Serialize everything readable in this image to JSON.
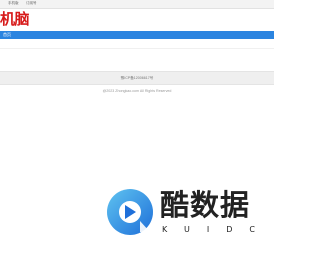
{
  "topbar": {
    "links": [
      "手机版",
      "订阅号"
    ]
  },
  "logo": {
    "text": "机脑"
  },
  "nav": {
    "items": [
      "首页"
    ]
  },
  "footer": {
    "icp": "豫ICP备12006617号",
    "copyright": "@2023 Zhongkao.com All Rights Reserved"
  },
  "watermark": {
    "brand": "酷数据",
    "sub": "KUIDC",
    "colors": {
      "gradient_start": "#5fc3f0",
      "gradient_end": "#1e6fd9",
      "text": "#222222"
    }
  },
  "colors": {
    "brand_red": "#d71a1a",
    "nav_blue": "#2b84e0"
  }
}
